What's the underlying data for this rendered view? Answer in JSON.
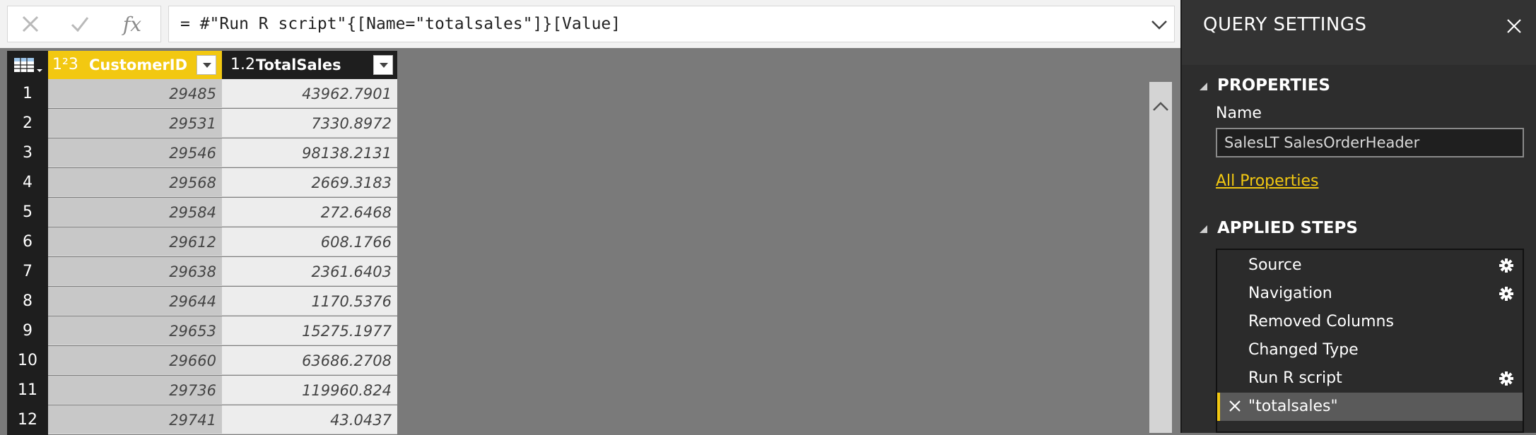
{
  "formula_bar": {
    "cancel_icon": "close-icon",
    "commit_icon": "check-icon",
    "fx_label": "fx",
    "formula": "= #\"Run R script\"{[Name=\"totalsales\"]}[Value]"
  },
  "grid": {
    "columns": [
      {
        "type_icon": "1²3",
        "name": "CustomerID"
      },
      {
        "type_icon": "1.2",
        "name": "TotalSales"
      }
    ],
    "rows": [
      {
        "n": "1",
        "customer": "29485",
        "total": "43962.7901"
      },
      {
        "n": "2",
        "customer": "29531",
        "total": "7330.8972"
      },
      {
        "n": "3",
        "customer": "29546",
        "total": "98138.2131"
      },
      {
        "n": "4",
        "customer": "29568",
        "total": "2669.3183"
      },
      {
        "n": "5",
        "customer": "29584",
        "total": "272.6468"
      },
      {
        "n": "6",
        "customer": "29612",
        "total": "608.1766"
      },
      {
        "n": "7",
        "customer": "29638",
        "total": "2361.6403"
      },
      {
        "n": "8",
        "customer": "29644",
        "total": "1170.5376"
      },
      {
        "n": "9",
        "customer": "29653",
        "total": "15275.1977"
      },
      {
        "n": "10",
        "customer": "29660",
        "total": "63686.2708"
      },
      {
        "n": "11",
        "customer": "29736",
        "total": "119960.824"
      },
      {
        "n": "12",
        "customer": "29741",
        "total": "43.0437"
      }
    ]
  },
  "panel": {
    "title": "QUERY SETTINGS",
    "properties_header": "PROPERTIES",
    "name_label": "Name",
    "name_value": "SalesLT SalesOrderHeader",
    "all_properties": "All Properties",
    "applied_steps_header": "APPLIED STEPS",
    "steps": [
      {
        "label": "Source",
        "gear": true
      },
      {
        "label": "Navigation",
        "gear": true
      },
      {
        "label": "Removed Columns",
        "gear": false
      },
      {
        "label": "Changed Type",
        "gear": false
      },
      {
        "label": "Run R script",
        "gear": true
      },
      {
        "label": "\"totalsales\"",
        "gear": false,
        "selected": true
      }
    ]
  },
  "colors": {
    "accent": "#f2c811",
    "panel_bg": "#2d2d2d",
    "workspace_bg": "#7a7a7a"
  }
}
